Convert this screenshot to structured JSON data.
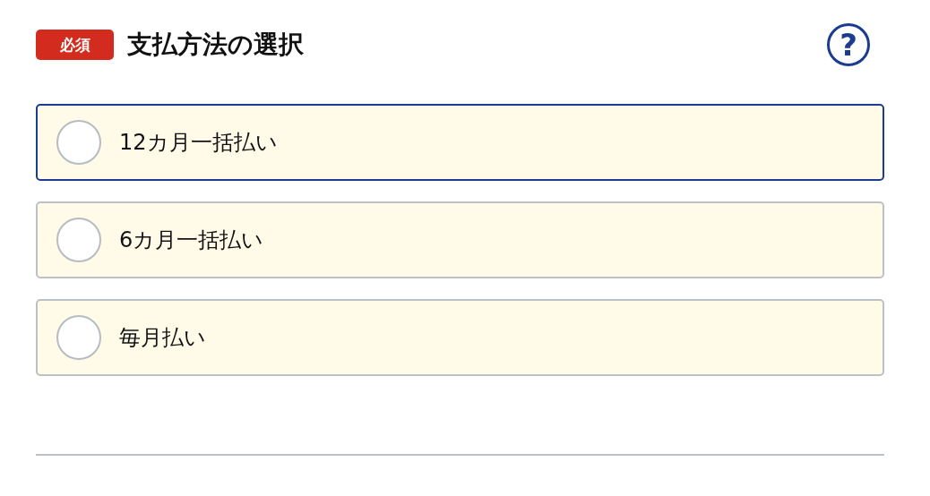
{
  "header": {
    "badge": "必須",
    "title": "支払方法の選択",
    "help_icon": "?"
  },
  "options": [
    {
      "label": "12カ月一括払い",
      "selected": false,
      "focused": true
    },
    {
      "label": "6カ月一括払い",
      "selected": false,
      "focused": false
    },
    {
      "label": "毎月払い",
      "selected": false,
      "focused": false
    }
  ]
}
